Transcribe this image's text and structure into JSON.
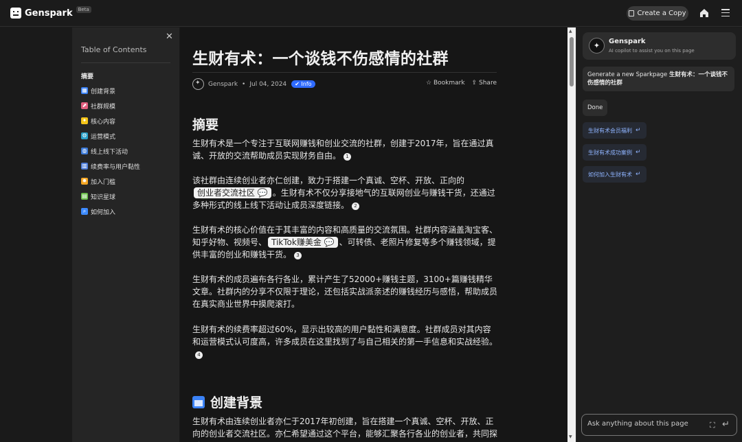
{
  "app": {
    "name": "Genspark",
    "badge": "Beta",
    "copy_label": "Create a Copy"
  },
  "toc": {
    "title": "Table of Contents",
    "items": [
      {
        "label": "摘要",
        "icon": "",
        "color": ""
      },
      {
        "label": "创建背景",
        "icon": "calendar-icon",
        "color": "#3b82f6"
      },
      {
        "label": "社群规模",
        "icon": "chart-icon",
        "color": "#e15f7f"
      },
      {
        "label": "核心内容",
        "icon": "bulb-icon",
        "color": "#f5c518"
      },
      {
        "label": "运营模式",
        "icon": "gear-icon",
        "color": "#2aa1c9"
      },
      {
        "label": "线上线下活动",
        "icon": "globe-icon",
        "color": "#3d7bd9"
      },
      {
        "label": "续费率与用户黏性",
        "icon": "bar-chart-icon",
        "color": "#4b7bd8"
      },
      {
        "label": "加入门槛",
        "icon": "star-icon",
        "color": "#f5a623"
      },
      {
        "label": "知识星球",
        "icon": "books-icon",
        "color": "#6abf4b"
      },
      {
        "label": "如何加入",
        "icon": "search-icon",
        "color": "#3d8bff"
      }
    ]
  },
  "article": {
    "title": "生财有术：一个谈钱不伤感情的社群",
    "author": "Genspark",
    "date": "Jul 04, 2024",
    "badge": "Info",
    "bookmark_label": "Bookmark",
    "share_label": "Share",
    "summary_heading": "摘要",
    "p1": "生财有术是一个专注于互联网赚钱和创业交流的社群，创建于2017年，旨在通过真诚、开放的交流帮助成员实现财务自由。",
    "p1_cite": "1",
    "p2a": "该社群由连续创业者亦仁创建，致力于搭建一个真诚、空杯、开放、正向的",
    "p2_chip": "创业者交流社区",
    "p2b": "。生财有术不仅分享接地气的互联网创业与赚钱干货，还通过多种形式的线上线下活动让成员深度链接。",
    "p2_cite": "2",
    "p3a": "生财有术的核心价值在于其丰富的内容和高质量的交流氛围。社群内容涵盖淘宝客、知乎好物、视频号、",
    "p3_chip": "TikTok赚美金",
    "p3b": "、可转债、老照片修复等多个赚钱领域，提供丰富的创业和赚钱干货。",
    "p3_cite": "3",
    "p4": "生财有术的成员遍布各行各业，累计产生了52000+赚钱主题，3100+篇赚钱精华文章。社群内的分享不仅限于理论，还包括实战派亲述的赚钱经历与感悟，帮助成员在真实商业世界中摸爬滚打。",
    "p5": "生财有术的续费率超过60%，显示出较高的用户黏性和满意度。社群成员对其内容和运营模式认可度高，许多成员在这里找到了与自己相关的第一手信息和实战经验。",
    "p5_cite": "4",
    "section2_heading": "创建背景",
    "p6": "生财有术由连续创业者亦仁于2017年初创建，旨在搭建一个真诚、空杯、开放、正向的创业者交流社区。亦仁希望通过这个平台，能够汇聚各行各业的创业者，共同探讨"
  },
  "assistant": {
    "name": "Genspark",
    "subtitle": "AI copilot to assist you on this page",
    "request_prefix": "Generate a new Sparkpage",
    "request_title": "生财有术：一个谈钱不伤感情的社群",
    "reply": "Done",
    "suggestions": [
      "生财有术会员福利",
      "生财有术成功案例",
      "如何加入生财有术"
    ],
    "ask_placeholder": "Ask anything about this page"
  }
}
